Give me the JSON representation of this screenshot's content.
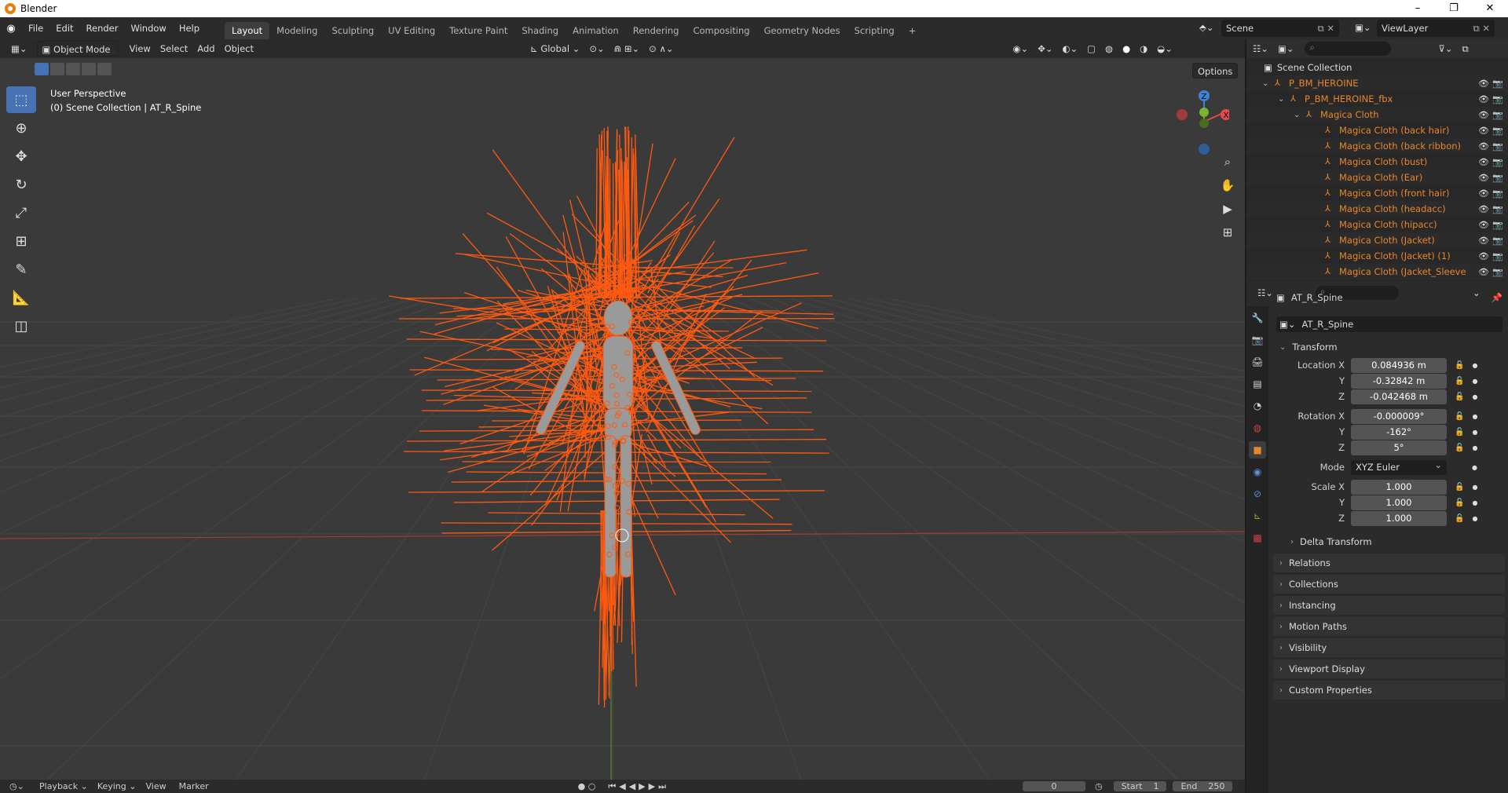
{
  "window": {
    "title": "Blender",
    "minimize": "–",
    "maximize": "❐",
    "close": "✕"
  },
  "menubar": {
    "items": [
      "File",
      "Edit",
      "Render",
      "Window",
      "Help"
    ],
    "workspaces": [
      "Layout",
      "Modeling",
      "Sculpting",
      "UV Editing",
      "Texture Paint",
      "Shading",
      "Animation",
      "Rendering",
      "Compositing",
      "Geometry Nodes",
      "Scripting"
    ],
    "active_workspace": "Layout",
    "add_tab": "+",
    "scene": "Scene",
    "view_layer": "ViewLayer"
  },
  "viewport": {
    "mode": "Object Mode",
    "menus": [
      "View",
      "Select",
      "Add",
      "Object"
    ],
    "transform_orientation": "Global",
    "options": "Options",
    "perspective": "User Perspective",
    "context": "(0) Scene Collection | AT_R_Spine",
    "gizmo_axes": {
      "z": "Z",
      "x": "X",
      "y": "Y"
    }
  },
  "timeline": {
    "menus": [
      "Playback",
      "Keying",
      "View",
      "Marker"
    ],
    "current_frame": "0",
    "start_label": "Start",
    "start": "1",
    "end_label": "End",
    "end": "250"
  },
  "outliner": {
    "root": "Scene Collection",
    "items": [
      {
        "label": "P_BM_HEROINE",
        "level": 0
      },
      {
        "label": "P_BM_HEROINE_fbx",
        "level": 1
      },
      {
        "label": "Magica Cloth",
        "level": 2
      },
      {
        "label": "Magica Cloth (back hair)",
        "level": 3
      },
      {
        "label": "Magica Cloth (back ribbon)",
        "level": 3
      },
      {
        "label": "Magica Cloth (bust)",
        "level": 3
      },
      {
        "label": "Magica Cloth (Ear)",
        "level": 3
      },
      {
        "label": "Magica Cloth (front hair)",
        "level": 3
      },
      {
        "label": "Magica Cloth (headacc)",
        "level": 3
      },
      {
        "label": "Magica Cloth (hipacc)",
        "level": 3
      },
      {
        "label": "Magica Cloth (Jacket)",
        "level": 3
      },
      {
        "label": "Magica Cloth (Jacket) (1)",
        "level": 3
      },
      {
        "label": "Magica Cloth (Jacket_Sleeve",
        "level": 3
      }
    ]
  },
  "properties": {
    "object_name": "AT_R_Spine",
    "object_field": "AT_R_Spine",
    "transform_label": "Transform",
    "location": {
      "label": "Location X",
      "x": "0.084936 m",
      "y": "-0.32842 m",
      "z": "-0.042468 m"
    },
    "rotation": {
      "label": "Rotation X",
      "x": "-0.000009°",
      "y": "-162°",
      "z": "5°"
    },
    "axis_y": "Y",
    "axis_z": "Z",
    "mode_label": "Mode",
    "mode_value": "XYZ Euler",
    "scale": {
      "label": "Scale X",
      "x": "1.000",
      "y": "1.000",
      "z": "1.000"
    },
    "sections": [
      "Delta Transform",
      "Relations",
      "Collections",
      "Instancing",
      "Motion Paths",
      "Visibility",
      "Viewport Display",
      "Custom Properties"
    ]
  },
  "colors": {
    "accent": "#4772b3",
    "armature": "#e8862d",
    "bones": "#ff5a10",
    "x_axis": "#e64a4a",
    "y_axis": "#7ab32d",
    "z_axis": "#3f83d6"
  }
}
